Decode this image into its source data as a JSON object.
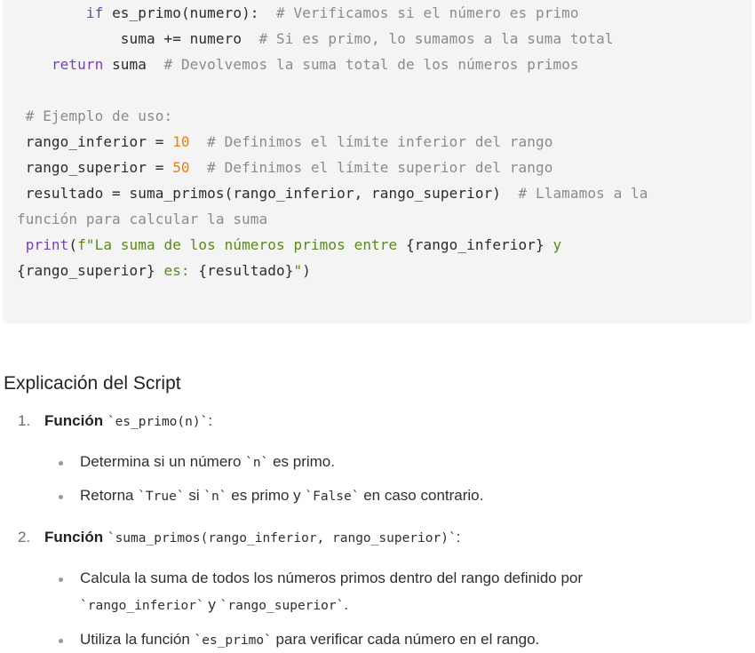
{
  "code": {
    "lines": [
      {
        "indent": "        ",
        "parts": [
          [
            "kw",
            "if"
          ],
          [
            "tx",
            " es_primo(numero):  "
          ],
          [
            "cm",
            "# Verificamos si el número es primo"
          ]
        ]
      },
      {
        "indent": "            ",
        "parts": [
          [
            "tx",
            "suma += numero  "
          ],
          [
            "cm",
            "# Si es primo, lo sumamos a la suma total"
          ]
        ]
      },
      {
        "indent": "    ",
        "parts": [
          [
            "kw",
            "return"
          ],
          [
            "tx",
            " suma  "
          ],
          [
            "cm",
            "# Devolvemos la suma total de los números primos"
          ]
        ]
      },
      {
        "indent": " ",
        "parts": [
          [
            "cm",
            "# Ejemplo de uso:"
          ]
        ]
      },
      {
        "indent": " ",
        "parts": [
          [
            "tx",
            "rango_inferior = "
          ],
          [
            "nm",
            "10"
          ],
          [
            "tx",
            "  "
          ],
          [
            "cm",
            "# Definimos el límite inferior del rango"
          ]
        ]
      },
      {
        "indent": " ",
        "parts": [
          [
            "tx",
            "rango_superior = "
          ],
          [
            "nm",
            "50"
          ],
          [
            "tx",
            "  "
          ],
          [
            "cm",
            "# Definimos el límite superior del rango"
          ]
        ]
      },
      {
        "indent": " ",
        "parts": [
          [
            "tx",
            "resultado = suma_primos(rango_inferior, rango_superior)  "
          ],
          [
            "cm",
            "# Llamamos a la"
          ]
        ]
      },
      {
        "indent": "",
        "parts": [
          [
            "cm",
            "función para calcular la suma"
          ]
        ]
      },
      {
        "indent": " ",
        "parts": [
          [
            "kw",
            "print"
          ],
          [
            "tx",
            "("
          ],
          [
            "st",
            "f\"La suma de los números primos entre "
          ],
          [
            "tx",
            "{rango_inferior}"
          ],
          [
            "st",
            " y"
          ]
        ]
      },
      {
        "indent": "",
        "parts": [
          [
            "tx",
            "{rango_superior}"
          ],
          [
            "st",
            " es: "
          ],
          [
            "tx",
            "{resultado}"
          ],
          [
            "st",
            "\""
          ],
          [
            "tx",
            ")"
          ]
        ]
      }
    ]
  },
  "heading": "Explicación del Script",
  "list": {
    "item1": {
      "num": "1.",
      "label": "Función",
      "code": "`es_primo(n)`",
      "tail": ":"
    },
    "item1_b1": {
      "a": "Determina si un número ",
      "c1": "`n`",
      "b": " es primo."
    },
    "item1_b2": {
      "a": "Retorna ",
      "c1": "`True`",
      "b": " si ",
      "c2": "`n`",
      "c": " es primo y ",
      "c3": "`False`",
      "d": " en caso contrario."
    },
    "item2": {
      "num": "2.",
      "label": "Función",
      "code": "`suma_primos(rango_inferior, rango_superior)`",
      "tail": ":"
    },
    "item2_b1": {
      "a": "Calcula la suma de todos los números primos dentro del rango definido por",
      "c1": "`rango_inferior`",
      "b": " y ",
      "c2": "`rango_superior`",
      "c": "."
    },
    "item2_b2": {
      "a": "Utiliza la función ",
      "c1": "`es_primo`",
      "b": " para verificar cada número en el rango."
    }
  }
}
